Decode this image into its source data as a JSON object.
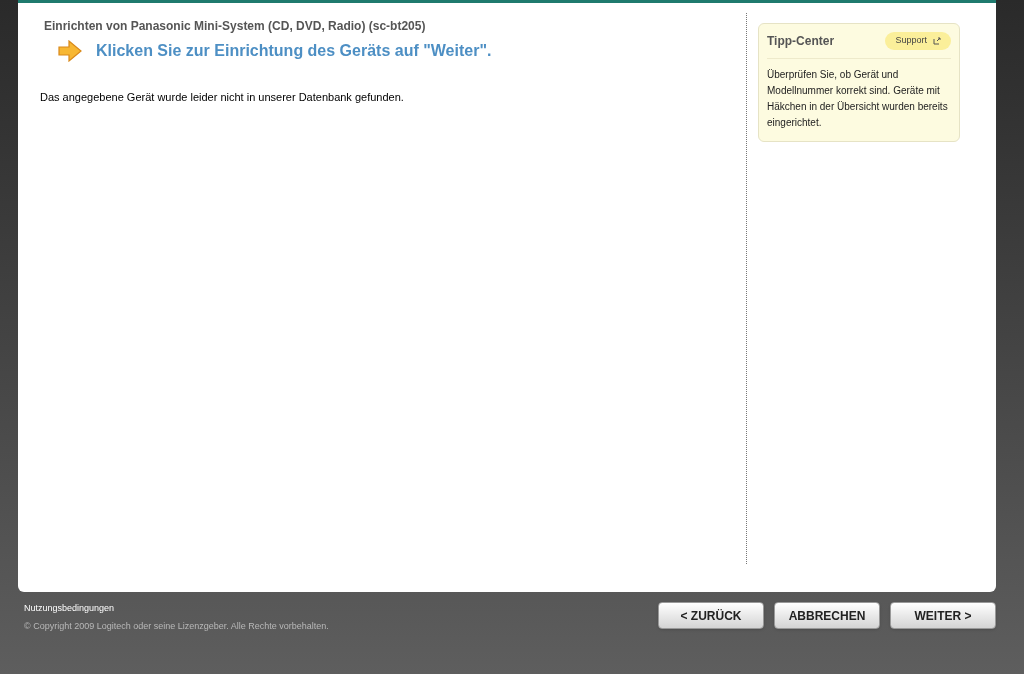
{
  "header": {
    "title": "Einrichten von Panasonic Mini-System (CD, DVD, Radio) (sc-bt205)",
    "instruction": "Klicken Sie zur Einrichtung des Geräts auf \"Weiter\"."
  },
  "message": "Das angegebene Gerät wurde leider nicht in unserer Datenbank gefunden.",
  "tip_center": {
    "title": "Tipp-Center",
    "support_button": "Support",
    "text": "Überprüfen Sie, ob Gerät und Modellnummer korrekt sind. Geräte mit Häkchen in der Übersicht wurden bereits eingerichtet."
  },
  "footer": {
    "terms_link": "Nutzungsbedingungen",
    "copyright": "© Copyright 2009 Logitech oder seine Lizenzgeber. Alle Rechte vorbehalten."
  },
  "buttons": [
    "< ZURÜCK",
    "ABBRECHEN",
    "WEITER >"
  ]
}
